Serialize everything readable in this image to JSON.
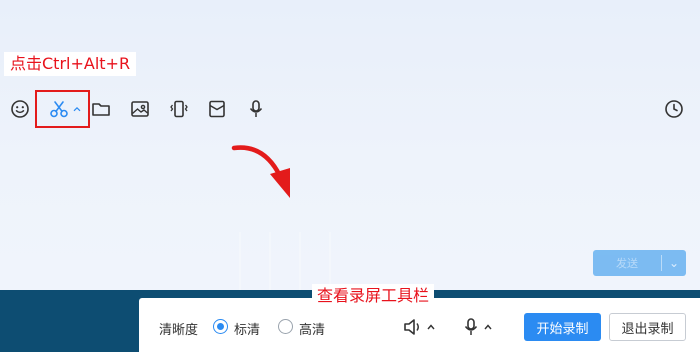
{
  "annotations": {
    "shortcut_label": "点击Ctrl+Alt+R",
    "record_toolbar_label": "查看录屏工具栏"
  },
  "chat_toolbar": {
    "icons": [
      "emoji-icon",
      "scissors-icon",
      "chevron-up-icon",
      "folder-icon",
      "image-icon",
      "vibrate-icon",
      "red-envelope-icon",
      "microphone-icon",
      "clock-icon"
    ]
  },
  "send_button": {
    "label": "发送"
  },
  "record_toolbar": {
    "clarity_label": "清晰度",
    "options": [
      {
        "label": "标清",
        "selected": true
      },
      {
        "label": "高清",
        "selected": false
      }
    ],
    "start_label": "开始录制",
    "exit_label": "退出录制"
  },
  "colors": {
    "accent": "#2b8bf2",
    "annotation_red": "#e8121c",
    "dark_strip": "#0d4d72"
  }
}
